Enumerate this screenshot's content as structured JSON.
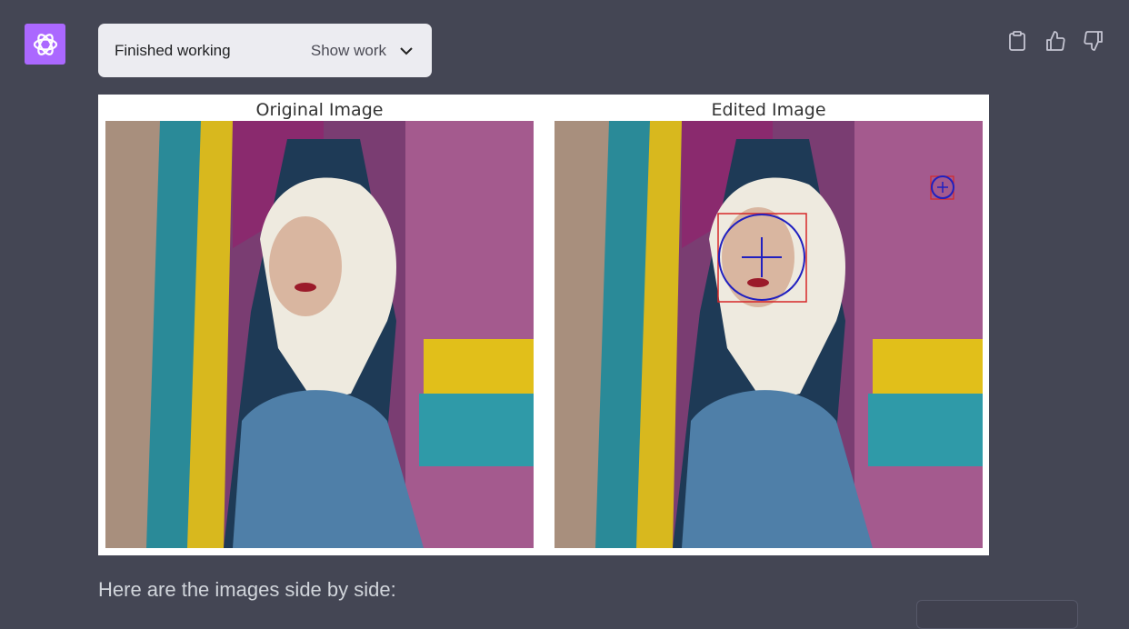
{
  "assistant": {
    "avatar_icon": "openai-logo-icon",
    "avatar_color": "#ab68ff"
  },
  "status": {
    "label": "Finished working",
    "toggle_label": "Show work",
    "toggle_icon": "chevron-down-icon"
  },
  "actions": {
    "icons": [
      "clipboard-icon",
      "thumbs-up-icon",
      "thumbs-down-icon"
    ]
  },
  "figure": {
    "left_title": "Original Image",
    "right_title": "Edited Image",
    "annotation_colors": {
      "box": "#d62728",
      "circle": "#2020c0"
    }
  },
  "message": {
    "text": "Here are the images side by side:"
  },
  "colors": {
    "background": "#444654",
    "pill": "#ececf1"
  }
}
